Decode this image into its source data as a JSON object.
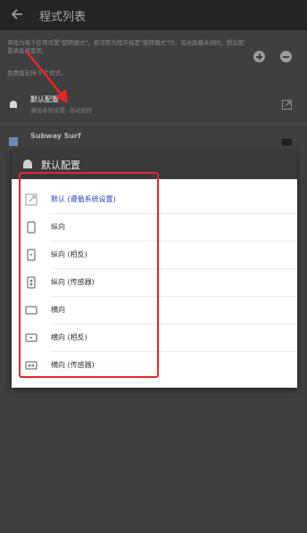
{
  "header": {
    "title": "程式列表"
  },
  "intro": {
    "description": "单独为每个应用设置\"旋转模式\"。如没有为程序指定\"旋转模式\"时，或当屏幕关闭时，默认配置将会被套用。",
    "count": "免费版支持 5 个程式。"
  },
  "list": [
    {
      "name": "默认配置",
      "sub": "遵循系统设置: 自动旋转"
    },
    {
      "name": "Subway Surf",
      "sub": ""
    }
  ],
  "dialog": {
    "title": "默认配置",
    "options": [
      {
        "label": "默认 (遵循系统设置)",
        "icon": "external-icon",
        "selected": true
      },
      {
        "label": "纵向",
        "icon": "portrait-icon"
      },
      {
        "label": "纵向 (相反)",
        "icon": "portrait-reverse-icon"
      },
      {
        "label": "纵向 (传感器)",
        "icon": "portrait-sensor-icon"
      },
      {
        "label": "横向",
        "icon": "landscape-icon"
      },
      {
        "label": "横向 (相反)",
        "icon": "landscape-reverse-icon"
      },
      {
        "label": "横向 (传感器)",
        "icon": "landscape-sensor-icon"
      }
    ]
  },
  "colors": {
    "accent": "#2a3fb8",
    "annotation": "#e8262a",
    "dialog_header": "#3a3a3a"
  }
}
